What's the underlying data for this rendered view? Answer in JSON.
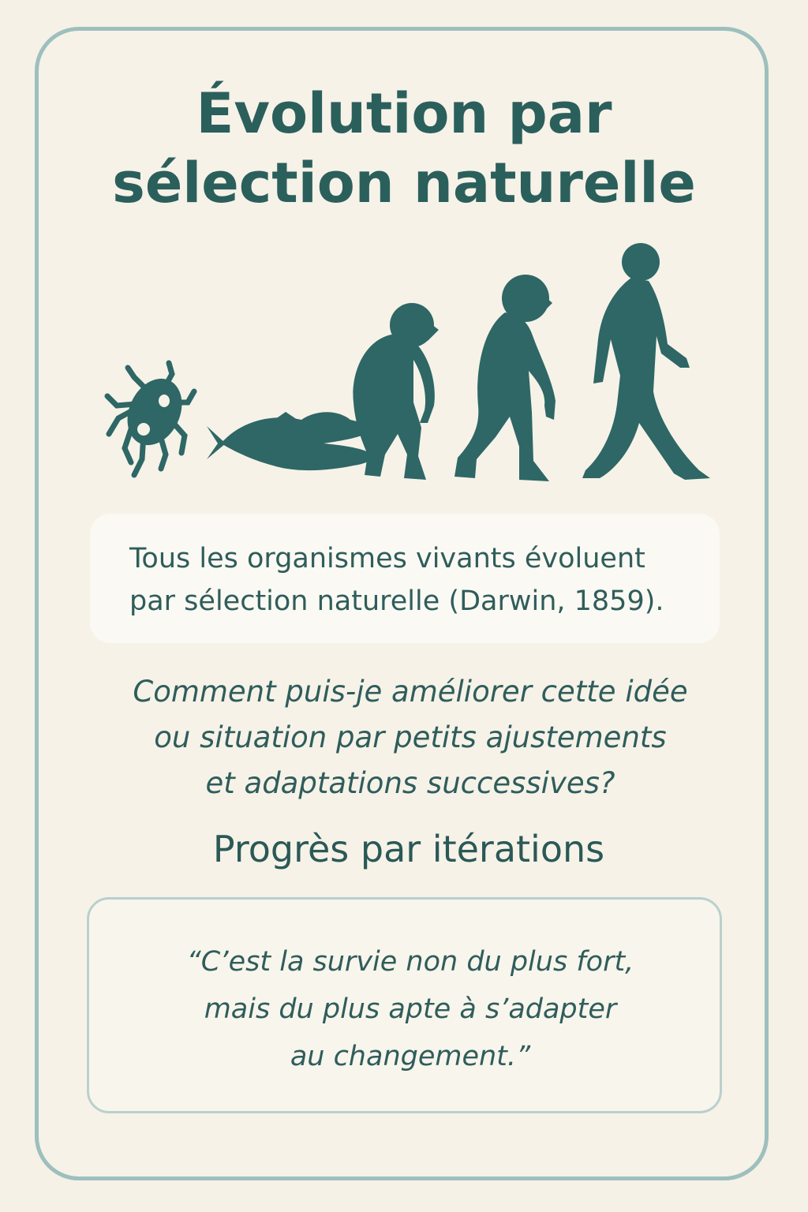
{
  "title": {
    "line1": "Évolution par",
    "line2": "sélection naturelle"
  },
  "illustration": {
    "icons": [
      "microbe-icon",
      "fish-icon",
      "ape-icon",
      "early-human-icon",
      "human-icon"
    ],
    "color": "#2e6765"
  },
  "statement": {
    "line1": "Tous les organismes vivants évoluent",
    "line2": "par sélection naturelle (Darwin, 1859)."
  },
  "question": {
    "line1": "Comment puis-je améliorer cette idée",
    "line2": "ou situation par petits ajustements",
    "line3": "et adaptations successives?"
  },
  "subtitle": "Progrès par itérations",
  "quote": {
    "line1": "“C’est la survie non du plus fort,",
    "line2": "mais du plus apte à s’adapter",
    "line3": "au changement.”"
  },
  "colors": {
    "background": "#f5f1e6",
    "border": "#9dbfbd",
    "text": "#2f5d5b"
  }
}
